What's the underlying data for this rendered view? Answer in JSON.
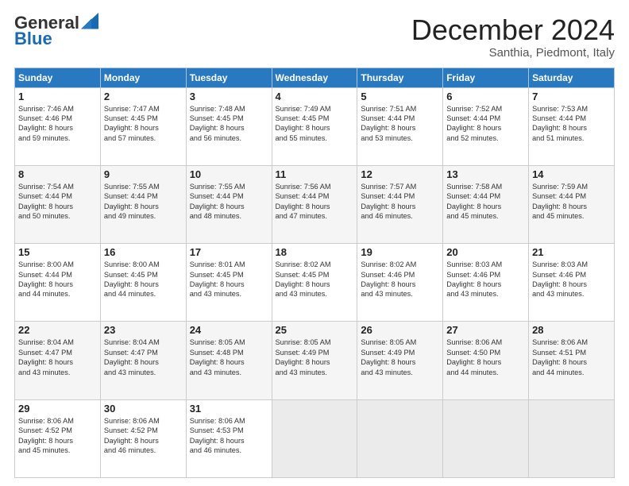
{
  "header": {
    "logo_general": "General",
    "logo_blue": "Blue",
    "month_title": "December 2024",
    "subtitle": "Santhia, Piedmont, Italy"
  },
  "days_of_week": [
    "Sunday",
    "Monday",
    "Tuesday",
    "Wednesday",
    "Thursday",
    "Friday",
    "Saturday"
  ],
  "weeks": [
    [
      {
        "day": "1",
        "text": "Sunrise: 7:46 AM\nSunset: 4:46 PM\nDaylight: 8 hours\nand 59 minutes."
      },
      {
        "day": "2",
        "text": "Sunrise: 7:47 AM\nSunset: 4:45 PM\nDaylight: 8 hours\nand 57 minutes."
      },
      {
        "day": "3",
        "text": "Sunrise: 7:48 AM\nSunset: 4:45 PM\nDaylight: 8 hours\nand 56 minutes."
      },
      {
        "day": "4",
        "text": "Sunrise: 7:49 AM\nSunset: 4:45 PM\nDaylight: 8 hours\nand 55 minutes."
      },
      {
        "day": "5",
        "text": "Sunrise: 7:51 AM\nSunset: 4:44 PM\nDaylight: 8 hours\nand 53 minutes."
      },
      {
        "day": "6",
        "text": "Sunrise: 7:52 AM\nSunset: 4:44 PM\nDaylight: 8 hours\nand 52 minutes."
      },
      {
        "day": "7",
        "text": "Sunrise: 7:53 AM\nSunset: 4:44 PM\nDaylight: 8 hours\nand 51 minutes."
      }
    ],
    [
      {
        "day": "8",
        "text": "Sunrise: 7:54 AM\nSunset: 4:44 PM\nDaylight: 8 hours\nand 50 minutes."
      },
      {
        "day": "9",
        "text": "Sunrise: 7:55 AM\nSunset: 4:44 PM\nDaylight: 8 hours\nand 49 minutes."
      },
      {
        "day": "10",
        "text": "Sunrise: 7:55 AM\nSunset: 4:44 PM\nDaylight: 8 hours\nand 48 minutes."
      },
      {
        "day": "11",
        "text": "Sunrise: 7:56 AM\nSunset: 4:44 PM\nDaylight: 8 hours\nand 47 minutes."
      },
      {
        "day": "12",
        "text": "Sunrise: 7:57 AM\nSunset: 4:44 PM\nDaylight: 8 hours\nand 46 minutes."
      },
      {
        "day": "13",
        "text": "Sunrise: 7:58 AM\nSunset: 4:44 PM\nDaylight: 8 hours\nand 45 minutes."
      },
      {
        "day": "14",
        "text": "Sunrise: 7:59 AM\nSunset: 4:44 PM\nDaylight: 8 hours\nand 45 minutes."
      }
    ],
    [
      {
        "day": "15",
        "text": "Sunrise: 8:00 AM\nSunset: 4:44 PM\nDaylight: 8 hours\nand 44 minutes."
      },
      {
        "day": "16",
        "text": "Sunrise: 8:00 AM\nSunset: 4:45 PM\nDaylight: 8 hours\nand 44 minutes."
      },
      {
        "day": "17",
        "text": "Sunrise: 8:01 AM\nSunset: 4:45 PM\nDaylight: 8 hours\nand 43 minutes."
      },
      {
        "day": "18",
        "text": "Sunrise: 8:02 AM\nSunset: 4:45 PM\nDaylight: 8 hours\nand 43 minutes."
      },
      {
        "day": "19",
        "text": "Sunrise: 8:02 AM\nSunset: 4:46 PM\nDaylight: 8 hours\nand 43 minutes."
      },
      {
        "day": "20",
        "text": "Sunrise: 8:03 AM\nSunset: 4:46 PM\nDaylight: 8 hours\nand 43 minutes."
      },
      {
        "day": "21",
        "text": "Sunrise: 8:03 AM\nSunset: 4:46 PM\nDaylight: 8 hours\nand 43 minutes."
      }
    ],
    [
      {
        "day": "22",
        "text": "Sunrise: 8:04 AM\nSunset: 4:47 PM\nDaylight: 8 hours\nand 43 minutes."
      },
      {
        "day": "23",
        "text": "Sunrise: 8:04 AM\nSunset: 4:47 PM\nDaylight: 8 hours\nand 43 minutes."
      },
      {
        "day": "24",
        "text": "Sunrise: 8:05 AM\nSunset: 4:48 PM\nDaylight: 8 hours\nand 43 minutes."
      },
      {
        "day": "25",
        "text": "Sunrise: 8:05 AM\nSunset: 4:49 PM\nDaylight: 8 hours\nand 43 minutes."
      },
      {
        "day": "26",
        "text": "Sunrise: 8:05 AM\nSunset: 4:49 PM\nDaylight: 8 hours\nand 43 minutes."
      },
      {
        "day": "27",
        "text": "Sunrise: 8:06 AM\nSunset: 4:50 PM\nDaylight: 8 hours\nand 44 minutes."
      },
      {
        "day": "28",
        "text": "Sunrise: 8:06 AM\nSunset: 4:51 PM\nDaylight: 8 hours\nand 44 minutes."
      }
    ],
    [
      {
        "day": "29",
        "text": "Sunrise: 8:06 AM\nSunset: 4:52 PM\nDaylight: 8 hours\nand 45 minutes."
      },
      {
        "day": "30",
        "text": "Sunrise: 8:06 AM\nSunset: 4:52 PM\nDaylight: 8 hours\nand 46 minutes."
      },
      {
        "day": "31",
        "text": "Sunrise: 8:06 AM\nSunset: 4:53 PM\nDaylight: 8 hours\nand 46 minutes."
      },
      {
        "day": "",
        "text": ""
      },
      {
        "day": "",
        "text": ""
      },
      {
        "day": "",
        "text": ""
      },
      {
        "day": "",
        "text": ""
      }
    ]
  ]
}
